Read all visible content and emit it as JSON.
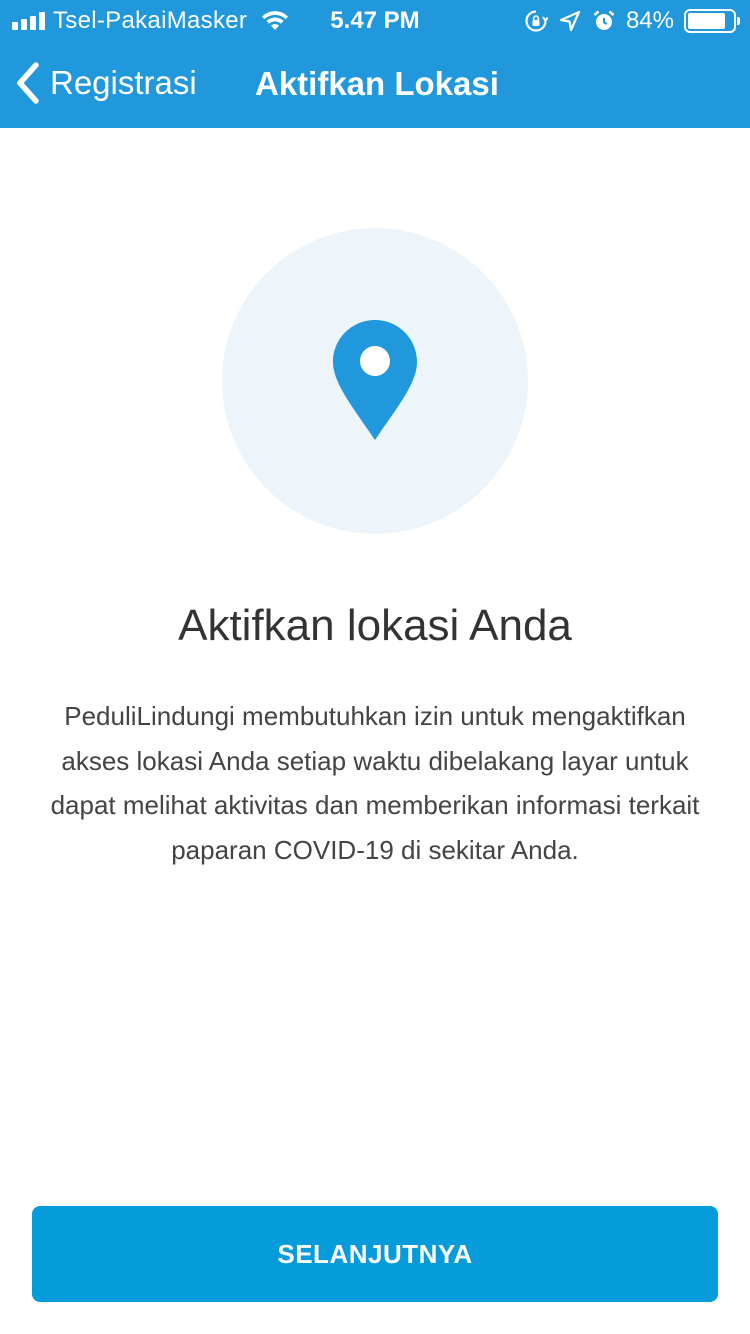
{
  "status_bar": {
    "carrier": "Tsel-PakaiMasker",
    "time": "5.47 PM",
    "battery_percent": "84%",
    "battery_level": 0.84,
    "icons": [
      "signal-icon",
      "wifi-icon",
      "orientation-lock-icon",
      "location-arrow-icon",
      "alarm-icon",
      "battery-icon"
    ]
  },
  "nav": {
    "back_label": "Registrasi",
    "title": "Aktifkan Lokasi"
  },
  "main": {
    "icon": "location-pin-icon",
    "heading": "Aktifkan lokasi Anda",
    "description": "PeduliLindungi membutuhkan izin untuk mengaktifkan akses lokasi Anda setiap waktu dibelakang layar untuk dapat melihat aktivitas dan memberikan informasi terkait paparan COVID-19 di sekitar Anda."
  },
  "footer": {
    "next_label": "SELANJUTNYA"
  },
  "colors": {
    "header_bg": "#2098db",
    "accent": "#2098db",
    "button_bg": "#069bdb",
    "circle_bg": "#edf5fb"
  }
}
